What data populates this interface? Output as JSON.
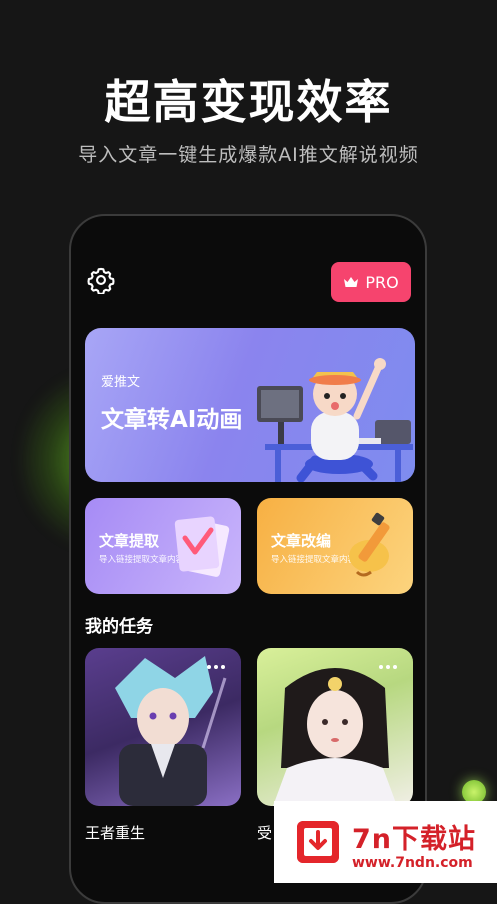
{
  "headline": "超高变现效率",
  "subline": "导入文章一键生成爆款AI推文解说视频",
  "app": {
    "settings_icon": "gear-icon",
    "pro_button": {
      "label": "PRO",
      "icon": "crown-icon",
      "color": "#f6446e"
    },
    "hero": {
      "brand": "爱推文",
      "title": "文章转AI动画"
    },
    "tools": [
      {
        "title": "文章提取",
        "subtitle": "导入链接提取文章内容"
      },
      {
        "title": "文章改编",
        "subtitle": "导入链接提取文章内容"
      }
    ],
    "section_title": "我的任务",
    "tasks": [
      {
        "name": "王者重生"
      },
      {
        "name": "受"
      }
    ]
  },
  "watermark": {
    "title": "7n下载站",
    "url": "www.7ndn.com"
  }
}
